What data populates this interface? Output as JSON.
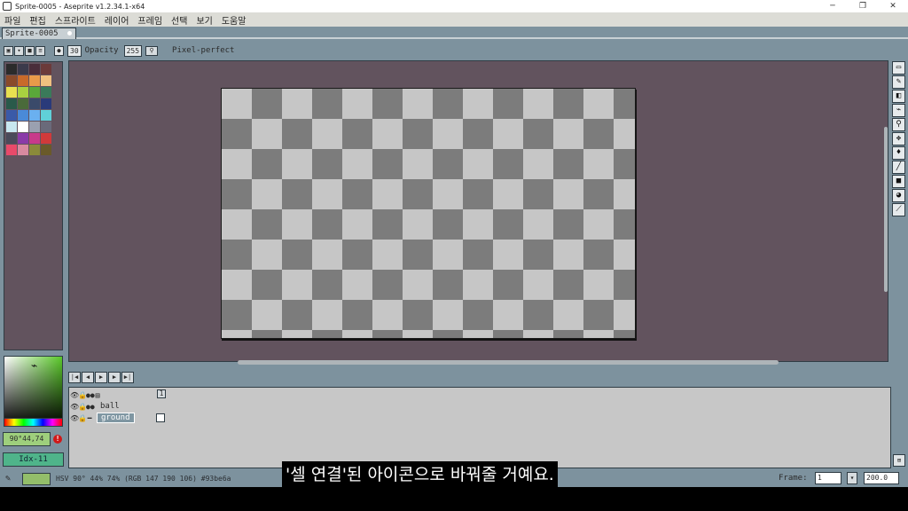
{
  "window": {
    "title": "Sprite-0005 - Aseprite v1.2.34.1-x64",
    "minimize": "─",
    "maximize": "❐",
    "close": "✕"
  },
  "menu": [
    "파일",
    "편집",
    "스프라이트",
    "레이어",
    "프레임",
    "선택",
    "보기",
    "도움말"
  ],
  "tab": {
    "label": "Sprite-0005"
  },
  "context_bar": {
    "brush_size": "30",
    "opacity_label": "Opacity",
    "opacity_value": "255",
    "pixel_perfect_label": "Pixel-perfect"
  },
  "palette": [
    "#2b2b2b",
    "#3b3a4b",
    "#4a2d3a",
    "#6b3a3a",
    "#8a4a2a",
    "#c86a2a",
    "#e89a4a",
    "#f0c080",
    "#e8e050",
    "#a8d040",
    "#5aa83a",
    "#3a7a5a",
    "#2a5a4a",
    "#4a6a3a",
    "#3a4a6a",
    "#2a3a7a",
    "#3a5aa8",
    "#4a8ad8",
    "#6ab0f0",
    "#60d0d8",
    "#c8e8f0",
    "#ffffff",
    "#9aa0b0",
    "#6a6a7a",
    "#4a4a5a",
    "#8a3aa8",
    "#c83a8a",
    "#d03a3a",
    "#e84a6a",
    "#d88aa0",
    "#8a8a3a",
    "#6a5a2a"
  ],
  "color": {
    "fg_hex": "#93be6a",
    "hsv_short": "90°44,74",
    "index": "Idx-11"
  },
  "timeline": {
    "controls": [
      "|◀",
      "◀",
      "▶",
      "▶",
      "▶|"
    ],
    "frame_number": "1",
    "layers": [
      {
        "name": "",
        "selected": false
      },
      {
        "name": "ball",
        "selected": false
      },
      {
        "name": "ground",
        "selected": true
      }
    ]
  },
  "tools": [
    "marquee-icon",
    "pencil-icon",
    "eraser-icon",
    "eyedropper-icon",
    "zoom-icon",
    "move-icon",
    "fill-icon",
    "line-icon",
    "rectangle-icon",
    "contour-icon",
    "blur-icon"
  ],
  "tool_glyphs": [
    "▭",
    "✎",
    "◧",
    "⌁",
    "⚲",
    "✥",
    "♦",
    "╱",
    "■",
    "◕",
    "⟋"
  ],
  "status": {
    "text": "HSV 90° 44% 74% (RGB 147 190 106) #93be6a",
    "frame_label": "Frame:",
    "frame_value": "1",
    "zoom": "200.0"
  },
  "subtitle": "'셀 연결'된 아이콘으로 바꿔줄 거예요."
}
